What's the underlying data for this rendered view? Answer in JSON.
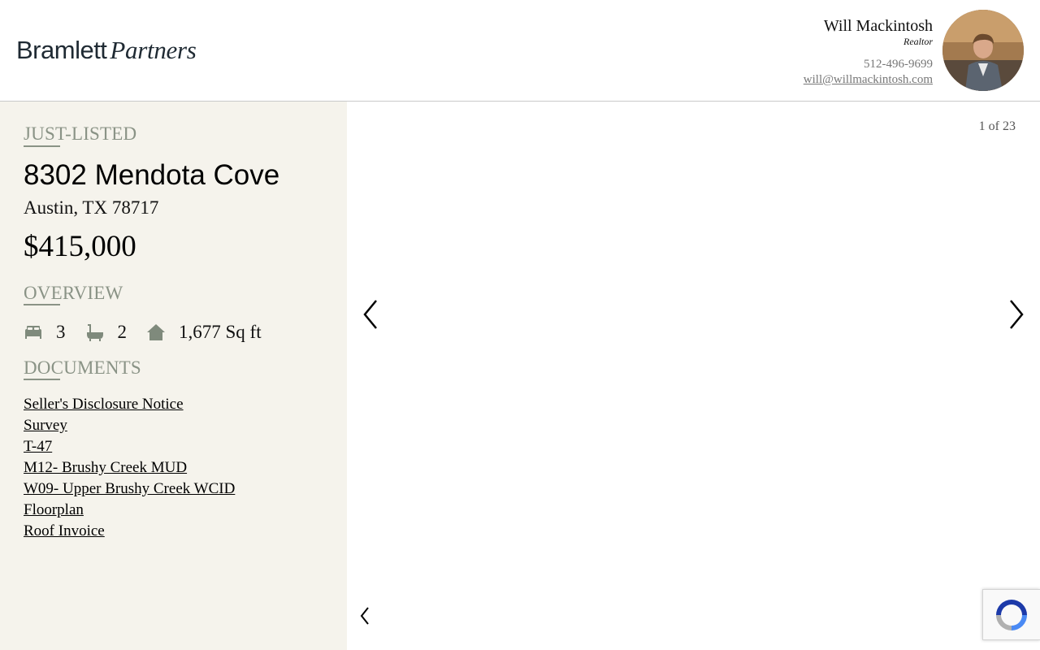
{
  "brand": {
    "logo_part1": "Bramlett",
    "logo_part2": "Partners"
  },
  "agent": {
    "name": "Will Mackintosh",
    "title": "Realtor",
    "phone": "512-496-9699",
    "email": "will@willmackintosh.com"
  },
  "listing": {
    "status": "JUST-LISTED",
    "address": "8302 Mendota Cove",
    "city_state_zip": "Austin, TX 78717",
    "price": "$415,000"
  },
  "overview": {
    "heading": "OVERVIEW",
    "beds": "3",
    "baths": "2",
    "sqft": "1,677 Sq ft"
  },
  "documents": {
    "heading": "DOCUMENTS",
    "items": [
      "Seller's Disclosure Notice",
      "Survey",
      "T-47",
      "M12- Brushy Creek MUD",
      "W09- Upper Brushy Creek WCID",
      "Floorplan",
      "Roof Invoice"
    ]
  },
  "gallery": {
    "counter": "1 of 23"
  },
  "colors": {
    "sidebar_bg": "#f5f3ec",
    "heading": "#8a9386",
    "icon": "#7f8a7c"
  },
  "icons": [
    "bed-icon",
    "bath-icon",
    "home-icon",
    "prev-arrow-icon",
    "next-arrow-icon",
    "recaptcha-icon"
  ]
}
